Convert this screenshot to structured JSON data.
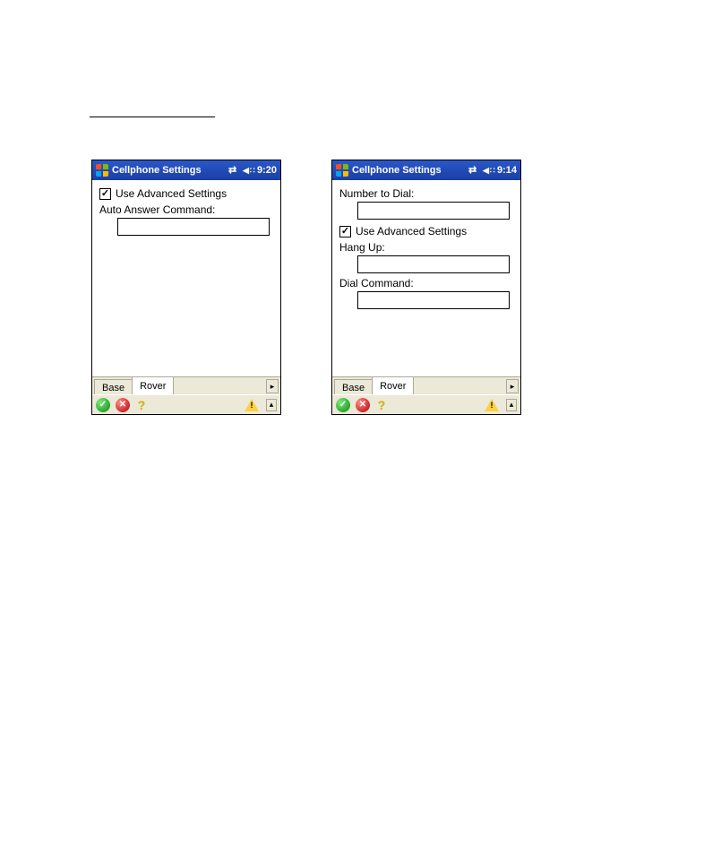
{
  "left": {
    "title": "Cellphone Settings",
    "clock": "9:20",
    "use_advanced_label": "Use Advanced Settings",
    "use_advanced_checked": true,
    "auto_answer_label": "Auto Answer Command:",
    "auto_answer_value": "",
    "tabs": {
      "base": "Base",
      "rover": "Rover",
      "active": "rover"
    }
  },
  "right": {
    "title": "Cellphone Settings",
    "clock": "9:14",
    "number_to_dial_label": "Number to Dial:",
    "number_to_dial_value": "",
    "use_advanced_label": "Use Advanced Settings",
    "use_advanced_checked": true,
    "hang_up_label": "Hang Up:",
    "hang_up_value": "",
    "dial_command_label": "Dial Command:",
    "dial_command_value": "",
    "tabs": {
      "base": "Base",
      "rover": "Rover",
      "active": "rover"
    }
  }
}
